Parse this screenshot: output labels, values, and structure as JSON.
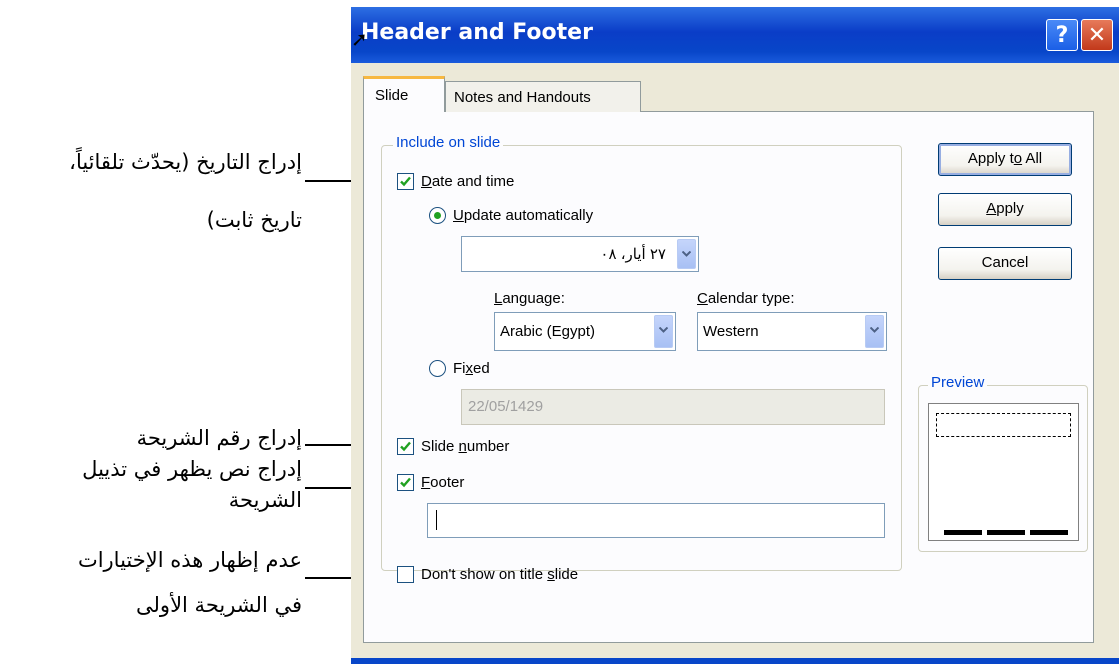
{
  "annotations": {
    "date_line1": "إدراج التاريخ (يحدّث تلقائياً،",
    "date_line2": "تاريخ ثابت)",
    "slide_number": "إدراج رقم الشريحة",
    "footer_line1": "إدراج نص يظهر في تذييل",
    "footer_line2": "الشريحة",
    "title_line1": "عدم إظهار هذه الإختيارات",
    "title_line2": "في الشريحة الأولى"
  },
  "dialog": {
    "title": "Header and Footer",
    "help_label": "?",
    "close_label": "✕",
    "tabs": [
      {
        "label": "Slide",
        "active": true
      },
      {
        "label": "Notes and Handouts",
        "active": false
      }
    ],
    "include_group_label": "Include on slide",
    "date_time": {
      "label": "Date and time",
      "checked": true
    },
    "update_auto": {
      "label": "Update automatically",
      "selected": true
    },
    "date_value": "٢٧ أيار، ٠٨",
    "language": {
      "label": "Language:",
      "value": "Arabic (Egypt)"
    },
    "calendar": {
      "label": "Calendar type:",
      "value": "Western"
    },
    "fixed": {
      "label": "Fixed",
      "selected": false,
      "value": "22/05/1429"
    },
    "slide_number": {
      "label": "Slide number",
      "checked": true
    },
    "footer": {
      "label": "Footer",
      "checked": true,
      "value": ""
    },
    "dont_show": {
      "label": "Don't show on title slide",
      "checked": false
    },
    "buttons": {
      "apply_all": "Apply to All",
      "apply": "Apply",
      "cancel": "Cancel"
    },
    "preview_label": "Preview"
  },
  "colors": {
    "titlebar": "#0a3dc7",
    "dialog_bg": "#ece9d8",
    "group_label": "#0046d5",
    "check_green": "#21a121"
  }
}
